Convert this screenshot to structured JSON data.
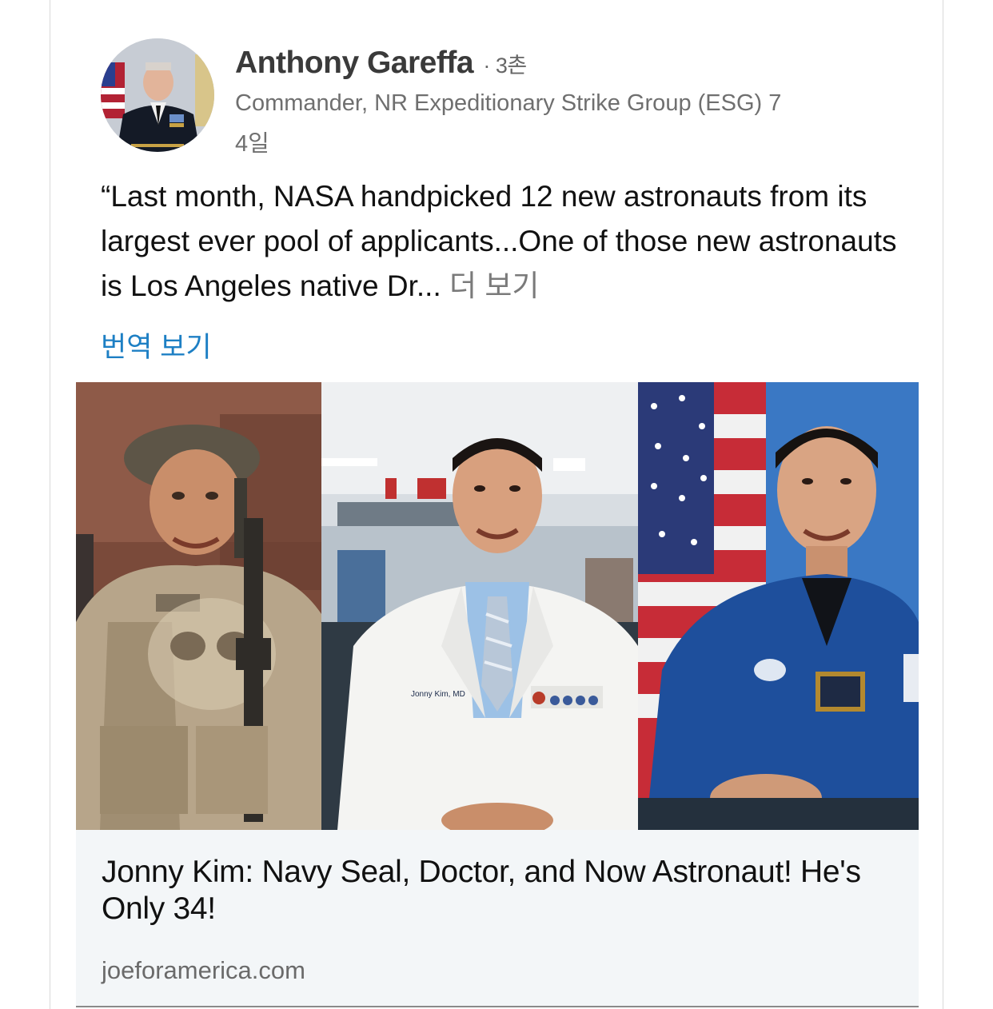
{
  "post": {
    "author_name": "Anthony Gareffa",
    "connection_degree": "· 3촌",
    "headline": "Commander, NR Expeditionary Strike Group (ESG) 7",
    "time": "4일",
    "text": "“Last month, NASA handpicked 12 new astronauts from its largest ever pool of applicants...One of those new astronauts is Los Angeles native Dr...",
    "see_more_label": "더 보기",
    "translate_label": "번역 보기"
  },
  "link_preview": {
    "title": "Jonny Kim: Navy Seal, Doctor, and Now Astronaut! He's Only 34!",
    "domain": "joeforamerica.com",
    "image_panels": [
      "navy-seal-photo",
      "doctor-photo",
      "astronaut-photo"
    ],
    "badge_text": "Jonny Kim, MD"
  },
  "colors": {
    "link_blue": "#1d7fc4",
    "preview_bg": "#f3f6f8",
    "text_dark": "#111111",
    "text_muted": "#6f6f6f"
  }
}
